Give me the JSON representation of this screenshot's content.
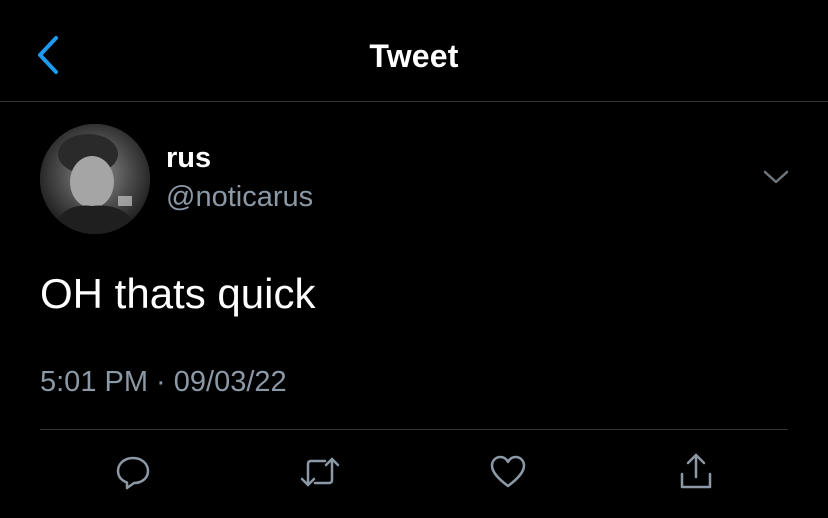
{
  "header": {
    "title": "Tweet",
    "back_icon": "chevron-left-icon",
    "accent_color": "#1d9bf0"
  },
  "tweet": {
    "author_name": "rus",
    "author_handle": "@noticarus",
    "text": "OH thats quick",
    "timestamp": "5:01 PM · 09/03/22"
  },
  "actions": [
    {
      "icon": "reply-icon"
    },
    {
      "icon": "retweet-icon"
    },
    {
      "icon": "like-icon"
    },
    {
      "icon": "share-icon"
    }
  ],
  "colors": {
    "background": "#000000",
    "primary_text": "#ffffff",
    "secondary_text": "#8b98a5",
    "divider": "#2f3336"
  }
}
